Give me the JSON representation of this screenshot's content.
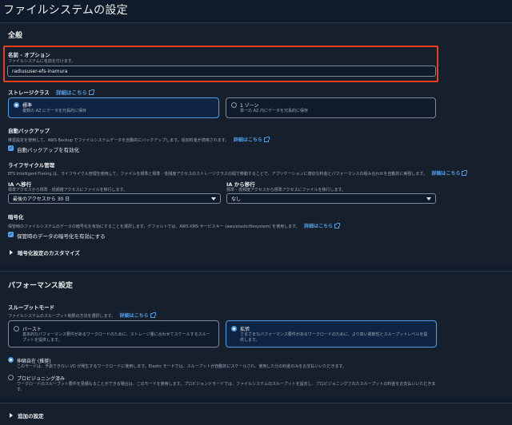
{
  "page": {
    "title": "ファイルシステムの設定"
  },
  "general": {
    "heading": "全般",
    "name": {
      "label": "名前 - オプション",
      "desc": "ファイルシステムに名前を付けます。",
      "value": "radiususer-efs-inamura"
    },
    "storage_class": {
      "label": "ストレージクラス",
      "info": "詳細はこちら",
      "options": [
        {
          "title": "標準",
          "desc": "複数の AZ にデータを冗長的に保存",
          "selected": true
        },
        {
          "title": "1 ゾーン",
          "desc": "単一の AZ 内にデータを冗長的に保存",
          "selected": false
        }
      ]
    },
    "backup": {
      "label": "自動バックアップ",
      "desc": "推奨設定を使用して、AWS Backup でファイルシステムデータを自動的にバックアップします。追加料金が適用されます。",
      "info": "詳細はこちら",
      "checkbox_label": "自動バックアップを有効化"
    },
    "lifecycle": {
      "label": "ライフサイクル管理",
      "desc": "EFS Intelligent-Tiering は、ライフサイクル管理を使用して、ファイルを標準と標準 - 低頻度アクセスのストレージクラスの間で移動することで、アプリケーションに適切な料金とパフォーマンスの組み合わせを自動的に実現します。",
      "info": "詳細はこちら",
      "to_ia": {
        "label": "IA へ移行",
        "desc": "標準アクセスから標準 - 低頻度アクセスにファイルを移行します。",
        "value": "最後のアクセスから 30 日"
      },
      "from_ia": {
        "label": "IA から移行",
        "desc": "標準 - 低頻度アクセスから標準アクセスにファイルを移行します。",
        "value": "なし"
      }
    },
    "encryption": {
      "label": "暗号化",
      "desc": "保管時のファイルシステムのデータの暗号化を有効にすることを選択します。デフォルトでは、AWS KMS サービスキー (aws/elasticfilesystem) を使用します。",
      "info": "詳細はこちら",
      "checkbox_label": "保管時のデータの暗号化を有効にする",
      "customize": "暗号化設定のカスタマイズ"
    }
  },
  "performance": {
    "heading": "パフォーマンス設定",
    "throughput": {
      "label": "スループットモード",
      "desc": "ファイルシステムのスループット制限の方法を選択します。",
      "info": "詳細はこちら",
      "burst": {
        "title": "バースト",
        "desc": "基本的なパフォーマンス要件があるワークロードのために、ストレージ量に合わせてスケールするスループットを提供します。",
        "selected": false
      },
      "enhanced": {
        "title": "拡張",
        "desc": "さまざまなパフォーマンス要件があるワークロードのために、より高い柔軟性とスループットレベルを提供します。",
        "selected": true
      },
      "elastic": {
        "title": "伸縮自在 (推奨)",
        "desc": "このモードは、予測できない I/O が発生するワークロードに使用します。Elastic モードでは、スループットが自動的にスケールされ、使用した分の料金のみをお支払いいただきます。",
        "selected": true
      },
      "provisioned": {
        "title": "プロビジョニング済み",
        "desc": "ワークロードのスループット要件を見積もることができる場合は、このモードを使用します。プロビジョンドモードでは、ファイルシステムのスループットを設定し、プロビジョニングされたスループットの料金をお支払いいただきます。",
        "selected": false
      }
    }
  },
  "additional": {
    "label": "追加の設定"
  }
}
